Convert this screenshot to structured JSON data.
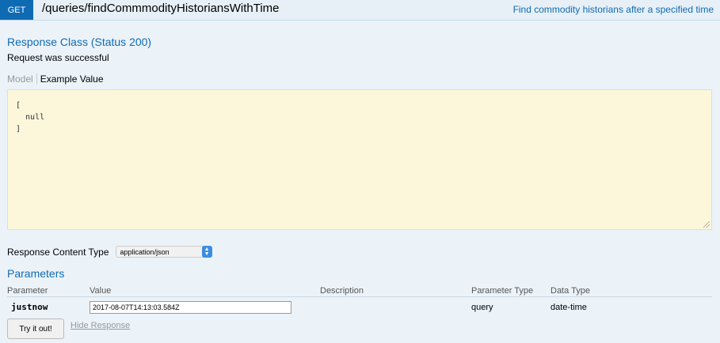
{
  "operation": {
    "method": "GET",
    "path": "/queries/findCommmodityHistoriansWithTime",
    "summary": "Find commodity historians after a specified time"
  },
  "response": {
    "heading": "Response Class (Status 200)",
    "message": "Request was successful",
    "tabs": {
      "model": "Model",
      "example": "Example Value"
    },
    "example_value": "[\n  null\n]",
    "content_type_label": "Response Content Type",
    "content_type_value": "application/json"
  },
  "parameters": {
    "heading": "Parameters",
    "columns": [
      "Parameter",
      "Value",
      "Description",
      "Parameter Type",
      "Data Type"
    ],
    "rows": [
      {
        "name": "justnow",
        "value": "2017-08-07T14:13:03.584Z",
        "description": "",
        "type": "query",
        "data_type": "date-time"
      }
    ]
  },
  "actions": {
    "try_label": "Try it out!",
    "hide_label": "Hide Response"
  },
  "colors": {
    "accent": "#0f6ab4",
    "background": "#ebf3f9",
    "example_bg": "#fcf6db"
  },
  "icons": {
    "select_arrow": "chevron-up-down-icon",
    "resize": "resize-grip-icon"
  }
}
